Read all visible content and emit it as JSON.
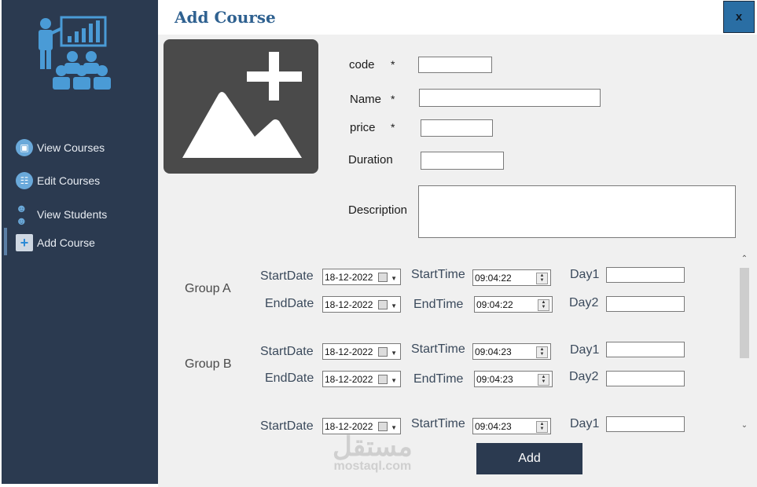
{
  "window": {
    "title": "Add Course",
    "close_label": "x"
  },
  "sidebar": {
    "items": [
      {
        "label": "View Courses",
        "icon": "book-icon"
      },
      {
        "label": "Edit Courses",
        "icon": "open-book-icon"
      },
      {
        "label": "View Students",
        "icon": "users-icon"
      },
      {
        "label": "Add Course",
        "icon": "plus-icon"
      }
    ],
    "active": "Add Course"
  },
  "form": {
    "code_label": "code",
    "name_label": "Name",
    "price_label": "price",
    "duration_label": "Duration",
    "description_label": "Description",
    "required_mark": "*",
    "code_value": "",
    "name_value": "",
    "price_value": "",
    "duration_value": "",
    "description_value": ""
  },
  "schedule": {
    "labels": {
      "start_date": "StartDate",
      "end_date": "EndDate",
      "start_time": "StartTime",
      "end_time": "EndTime",
      "day1": "Day1",
      "day2": "Day2"
    },
    "groups": [
      {
        "name": "Group A",
        "start_date": "18-12-2022",
        "end_date": "18-12-2022",
        "start_time": "09:04:22",
        "end_time": "09:04:22"
      },
      {
        "name": "Group B",
        "start_date": "18-12-2022",
        "end_date": "18-12-2022",
        "start_time": "09:04:23",
        "end_time": "09:04:23"
      },
      {
        "name": "",
        "start_date": "18-12-2022",
        "start_time": "09:04:23"
      }
    ]
  },
  "actions": {
    "add_label": "Add"
  },
  "watermark": {
    "arabic": "مستقل",
    "latin": "mostaql.com"
  },
  "colors": {
    "sidebar": "#2b3a50",
    "accent": "#2f6190",
    "close": "#2a6ea4"
  }
}
